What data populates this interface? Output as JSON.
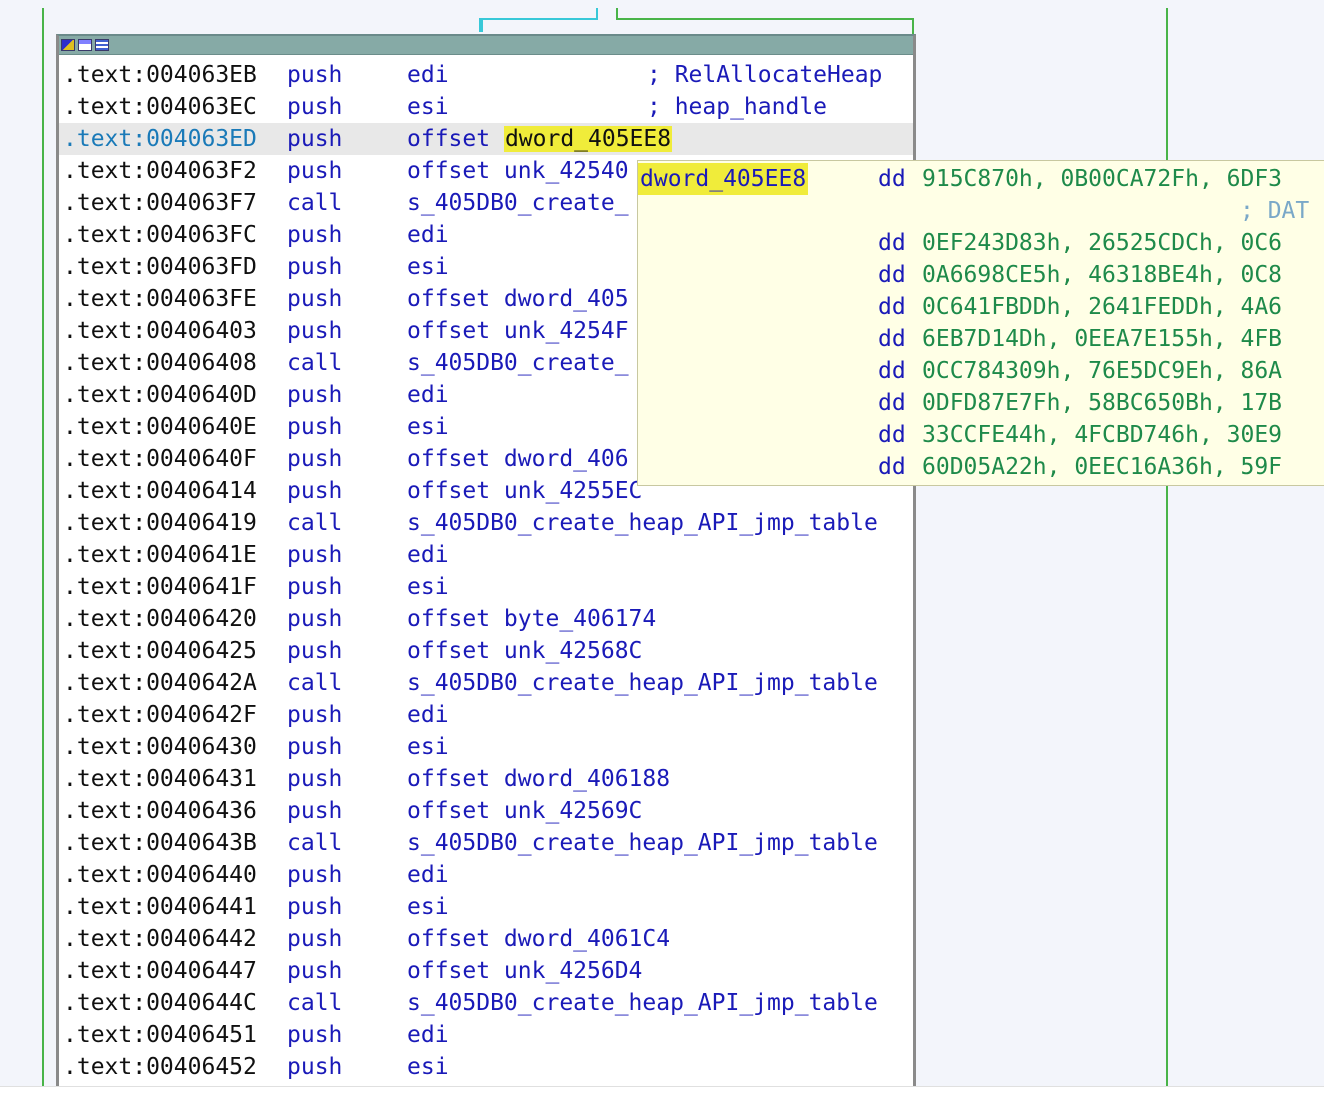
{
  "window": {
    "title_icons": [
      "graph-overview-icon",
      "graph-icon",
      "text-view-icon"
    ]
  },
  "selected_row_index": 2,
  "highlighted_operand": "dword_405EE8",
  "rows": [
    {
      "addr": ".text:004063EB",
      "mnem": "push",
      "oper": "edi",
      "comment": "; RelAllocateHeap"
    },
    {
      "addr": ".text:004063EC",
      "mnem": "push",
      "oper": "esi",
      "comment": "; heap_handle"
    },
    {
      "addr": ".text:004063ED",
      "mnem": "push",
      "oper_kw": "offset",
      "oper_hl": "dword_405EE8",
      "oper": "",
      "comment": ""
    },
    {
      "addr": ".text:004063F2",
      "mnem": "push",
      "oper": "offset unk_42540",
      "comment": ""
    },
    {
      "addr": ".text:004063F7",
      "mnem": "call",
      "oper": "s_405DB0_create_",
      "comment": ""
    },
    {
      "addr": ".text:004063FC",
      "mnem": "push",
      "oper": "edi",
      "comment": ""
    },
    {
      "addr": ".text:004063FD",
      "mnem": "push",
      "oper": "esi",
      "comment": ""
    },
    {
      "addr": ".text:004063FE",
      "mnem": "push",
      "oper": "offset dword_405",
      "comment": ""
    },
    {
      "addr": ".text:00406403",
      "mnem": "push",
      "oper": "offset unk_4254F",
      "comment": ""
    },
    {
      "addr": ".text:00406408",
      "mnem": "call",
      "oper": "s_405DB0_create_",
      "comment": ""
    },
    {
      "addr": ".text:0040640D",
      "mnem": "push",
      "oper": "edi",
      "comment": ""
    },
    {
      "addr": ".text:0040640E",
      "mnem": "push",
      "oper": "esi",
      "comment": ""
    },
    {
      "addr": ".text:0040640F",
      "mnem": "push",
      "oper": "offset dword_406",
      "comment": ""
    },
    {
      "addr": ".text:00406414",
      "mnem": "push",
      "oper": "offset unk_4255EC",
      "comment": ""
    },
    {
      "addr": ".text:00406419",
      "mnem": "call",
      "oper": "s_405DB0_create_heap_API_jmp_table",
      "comment": ""
    },
    {
      "addr": ".text:0040641E",
      "mnem": "push",
      "oper": "edi",
      "comment": ""
    },
    {
      "addr": ".text:0040641F",
      "mnem": "push",
      "oper": "esi",
      "comment": ""
    },
    {
      "addr": ".text:00406420",
      "mnem": "push",
      "oper": "offset byte_406174",
      "comment": ""
    },
    {
      "addr": ".text:00406425",
      "mnem": "push",
      "oper": "offset unk_42568C",
      "comment": ""
    },
    {
      "addr": ".text:0040642A",
      "mnem": "call",
      "oper": "s_405DB0_create_heap_API_jmp_table",
      "comment": ""
    },
    {
      "addr": ".text:0040642F",
      "mnem": "push",
      "oper": "edi",
      "comment": ""
    },
    {
      "addr": ".text:00406430",
      "mnem": "push",
      "oper": "esi",
      "comment": ""
    },
    {
      "addr": ".text:00406431",
      "mnem": "push",
      "oper": "offset dword_406188",
      "comment": ""
    },
    {
      "addr": ".text:00406436",
      "mnem": "push",
      "oper": "offset unk_42569C",
      "comment": ""
    },
    {
      "addr": ".text:0040643B",
      "mnem": "call",
      "oper": "s_405DB0_create_heap_API_jmp_table",
      "comment": ""
    },
    {
      "addr": ".text:00406440",
      "mnem": "push",
      "oper": "edi",
      "comment": ""
    },
    {
      "addr": ".text:00406441",
      "mnem": "push",
      "oper": "esi",
      "comment": ""
    },
    {
      "addr": ".text:00406442",
      "mnem": "push",
      "oper": "offset dword_4061C4",
      "comment": ""
    },
    {
      "addr": ".text:00406447",
      "mnem": "push",
      "oper": "offset unk_4256D4",
      "comment": ""
    },
    {
      "addr": ".text:0040644C",
      "mnem": "call",
      "oper": "s_405DB0_create_heap_API_jmp_table",
      "comment": ""
    },
    {
      "addr": ".text:00406451",
      "mnem": "push",
      "oper": "edi",
      "comment": ""
    },
    {
      "addr": ".text:00406452",
      "mnem": "push",
      "oper": "esi",
      "comment": ""
    }
  ],
  "hint": {
    "name": "dword_405EE8",
    "lines": [
      {
        "dd": "dd",
        "vals": "915C870h, 0B00CA72Fh, 6DF3"
      },
      {
        "dd": "",
        "vals": "",
        "comment": "; DAT"
      },
      {
        "dd": "dd",
        "vals": "0EF243D83h, 26525CDCh, 0C6"
      },
      {
        "dd": "dd",
        "vals": "0A6698CE5h, 46318BE4h, 0C8"
      },
      {
        "dd": "dd",
        "vals": "0C641FBDDh, 2641FEDDh, 4A6"
      },
      {
        "dd": "dd",
        "vals": "6EB7D14Dh, 0EEA7E155h, 4FB"
      },
      {
        "dd": "dd",
        "vals": "0CC784309h, 76E5DC9Eh, 86A"
      },
      {
        "dd": "dd",
        "vals": "0DFD87E7Fh, 58BC650Bh, 17B"
      },
      {
        "dd": "dd",
        "vals": "33CCFE44h, 4FCBD746h, 30E9"
      },
      {
        "dd": "dd",
        "vals": "60D05A22h, 0EEC16A36h, 59F"
      }
    ]
  },
  "colors": {
    "edge_green": "#49b449",
    "edge_cyan": "#38c8d8",
    "highlight": "#f0ec3a",
    "hint_bg": "#ffffe6",
    "code_blue": "#1a1ab8",
    "hex_green": "#1e8a4a"
  }
}
